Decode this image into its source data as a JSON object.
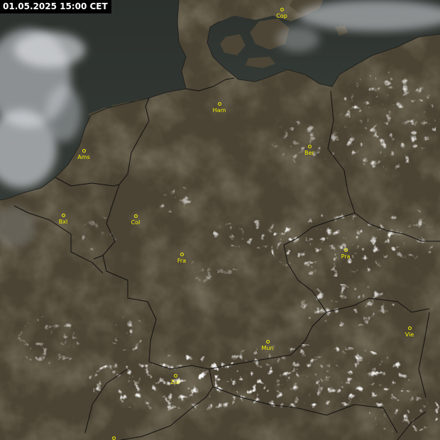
{
  "header": {
    "timestamp": "01.05.2025 15:00 CET"
  },
  "colors": {
    "land": "#4b4333",
    "sea": "#2f3430",
    "border": "#111111",
    "label": "#f2f000",
    "cloud": "#e6e8ec"
  },
  "cities": [
    {
      "id": "cop",
      "label": "Cop"
    },
    {
      "id": "ham",
      "label": "Ham"
    },
    {
      "id": "ams",
      "label": "Ams"
    },
    {
      "id": "ber",
      "label": "Ber"
    },
    {
      "id": "bxl",
      "label": "Bxl"
    },
    {
      "id": "col",
      "label": "Col"
    },
    {
      "id": "fra",
      "label": "Fra"
    },
    {
      "id": "pra",
      "label": "Pra"
    },
    {
      "id": "mun",
      "label": "Mun"
    },
    {
      "id": "vie",
      "label": "Vie"
    },
    {
      "id": "zur",
      "label": "Zur"
    }
  ]
}
